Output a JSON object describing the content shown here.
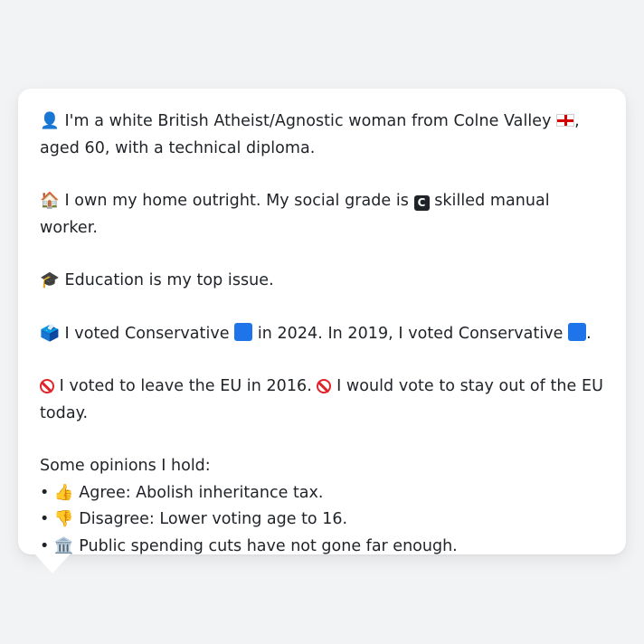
{
  "card": {
    "intro": {
      "icon": "👤",
      "text_before_flag": "I'm a white British Atheist/Agnostic woman from Colne Valley",
      "flag_icon": "england-flag",
      "text_after_flag": ", aged 60, with a technical diploma."
    },
    "home": {
      "icon": "🏠",
      "text_before_badge": "I own my home outright. My social grade is",
      "badge_letter": "C",
      "text_after_badge": "skilled manual worker."
    },
    "education": {
      "icon": "🎓",
      "text": "Education is my top issue."
    },
    "vote": {
      "icon": "🗳️",
      "text_part1": "I voted Conservative",
      "text_part2": "in 2024. In 2019, I voted Conservative",
      "text_part3": ".",
      "party_color": "#1e74e8"
    },
    "eu": {
      "text_part1": "I voted to leave the EU in 2016.",
      "text_part2": "I would vote to stay out of the EU today.",
      "no_entry_color": "#e0242a"
    },
    "opinions": {
      "heading": "Some opinions I hold:",
      "bullet": "•",
      "items": [
        {
          "icon": "👍",
          "text": "Agree: Abolish inheritance tax."
        },
        {
          "icon": "👎",
          "text": "Disagree: Lower voting age to 16."
        },
        {
          "icon": "🏛️",
          "text": "Public spending cuts have not gone far enough."
        }
      ]
    }
  }
}
